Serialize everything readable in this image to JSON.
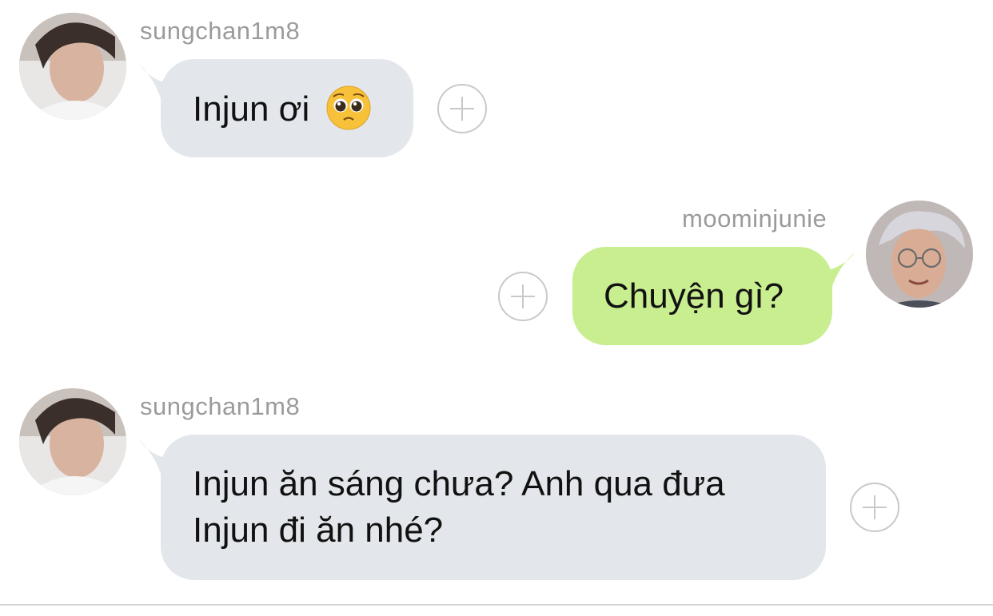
{
  "messages": [
    {
      "sender": "sungchan1m8",
      "direction": "incoming",
      "text": "Injun ơi",
      "emoji": "pleading-face-emoji"
    },
    {
      "sender": "moominjunie",
      "direction": "outgoing",
      "text": "Chuyện gì?"
    },
    {
      "sender": "sungchan1m8",
      "direction": "incoming",
      "text_line1": "Injun ăn sáng chưa? Anh qua đưa",
      "text_line2": "Injun đi ăn nhé?"
    }
  ],
  "colors": {
    "incoming_bubble": "#e3e6ea",
    "outgoing_bubble": "#c8ee8f",
    "username": "#9b9b9b",
    "plus_icon": "#c9c9c9"
  },
  "icons": {
    "reaction": "plus-circle-icon"
  }
}
